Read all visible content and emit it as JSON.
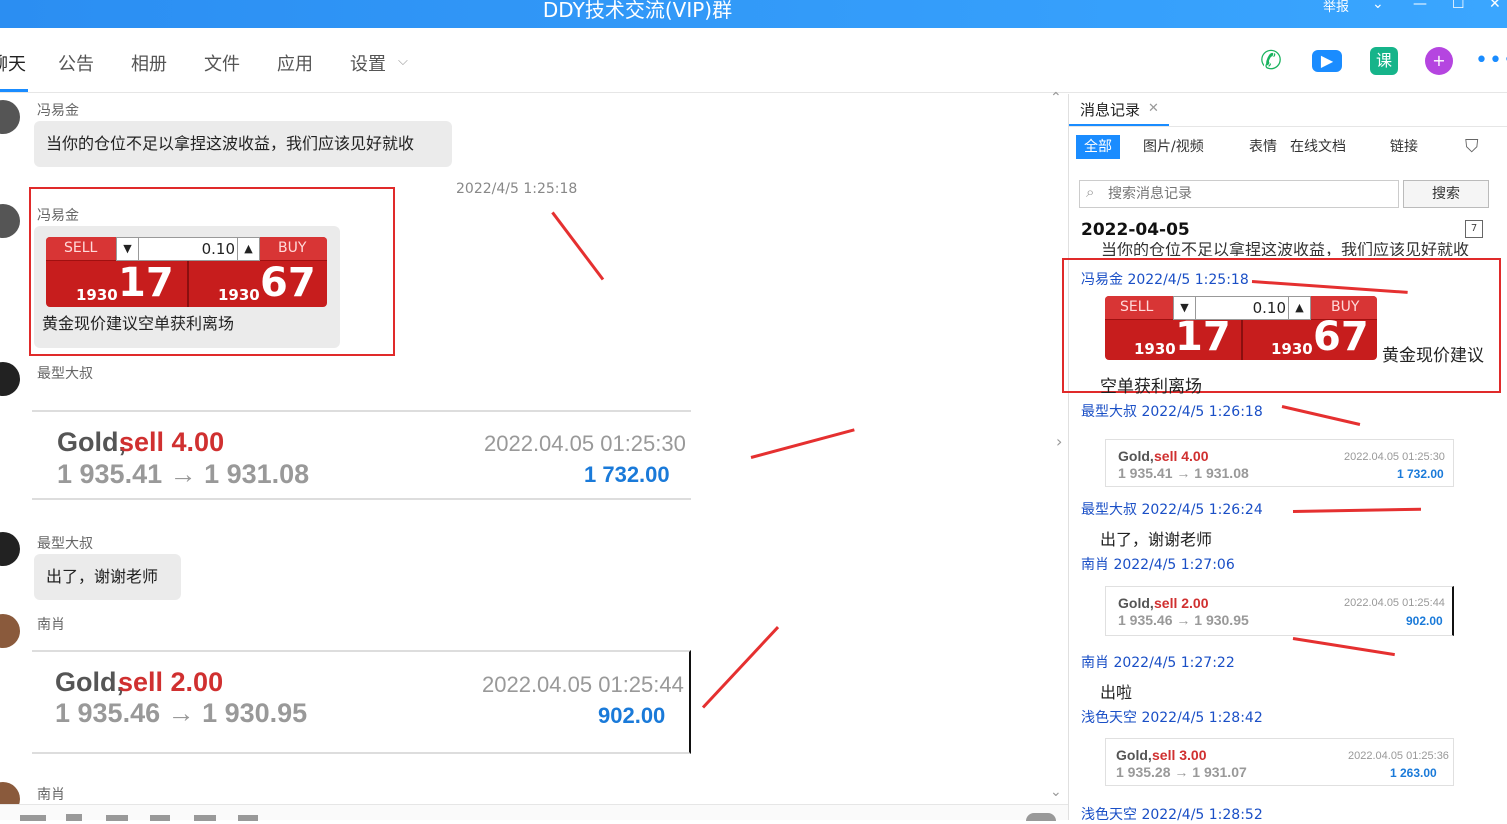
{
  "window": {
    "title": "DDY技术交流(VIP)群",
    "report": "举报"
  },
  "tabs": [
    {
      "label": "聊天"
    },
    {
      "label": "公告"
    },
    {
      "label": "相册"
    },
    {
      "label": "文件"
    },
    {
      "label": "应用"
    },
    {
      "label": "设置"
    }
  ],
  "chat": {
    "messages": [
      {
        "sender": "冯易金",
        "text": "当你的仓位不足以拿捏这波收益，我们应该见好就收"
      },
      {
        "timestamp": "2022/4/5 1:25:18",
        "sender": "冯易金",
        "widget": {
          "sell": "SELL",
          "buy": "BUY",
          "lot": "0.10",
          "sell_small": "1930",
          "sell_big": "17",
          "buy_small": "1930",
          "buy_big": "67"
        },
        "text": "黄金现价建议空单获利离场"
      },
      {
        "sender": "最型大叔",
        "card": {
          "gold": "Gold,",
          "sell": "sell 4.00",
          "prices": "1 935.41 → 1 931.08",
          "date": "2022.04.05 01:25:30",
          "profit": "1 732.00"
        }
      },
      {
        "sender": "最型大叔",
        "text": "出了，谢谢老师"
      },
      {
        "sender": "南肖",
        "card": {
          "gold": "Gold,",
          "sell": "sell 2.00",
          "prices": "1 935.46 → 1 930.95",
          "date": "2022.04.05 01:25:44",
          "profit": "902.00"
        }
      },
      {
        "sender": "南肖"
      }
    ]
  },
  "panel": {
    "title": "消息记录",
    "filters": [
      {
        "label": "全部"
      },
      {
        "label": "图片/视频"
      },
      {
        "label": "表情"
      },
      {
        "label": "在线文档"
      },
      {
        "label": "链接"
      }
    ],
    "search_placeholder": "搜索消息记录",
    "search_button": "搜索",
    "date": "2022-04-05",
    "cut_text": "当你的仓位不足以拿捏这波收益，我们应该见好就收",
    "entries": [
      {
        "header": "冯易金 2022/4/5 1:25:18",
        "widget": {
          "sell": "SELL",
          "buy": "BUY",
          "lot": "0.10",
          "sell_small": "1930",
          "sell_big": "17",
          "buy_small": "1930",
          "buy_big": "67"
        },
        "text1": "黄金现价建议",
        "text2": "空单获利离场"
      },
      {
        "header": "最型大叔 2022/4/5 1:26:18",
        "card": {
          "gold": "Gold,",
          "sell": "sell 4.00",
          "prices": "1 935.41 → 1 931.08",
          "date": "2022.04.05 01:25:30",
          "profit": "1 732.00"
        }
      },
      {
        "header": "最型大叔 2022/4/5 1:26:24",
        "text": "出了，谢谢老师"
      },
      {
        "header": "南肖 2022/4/5 1:27:06",
        "card": {
          "gold": "Gold,",
          "sell": "sell 2.00",
          "prices": "1 935.46 → 1 930.95",
          "date": "2022.04.05 01:25:44",
          "profit": "902.00"
        }
      },
      {
        "header": "南肖 2022/4/5 1:27:22",
        "text": "出啦"
      },
      {
        "header": "浅色天空 2022/4/5 1:28:42",
        "card": {
          "gold": "Gold,",
          "sell": "sell 3.00",
          "prices": "1 935.28 → 1 931.07",
          "date": "2022.04.05 01:25:36",
          "profit": "1 263.00"
        }
      },
      {
        "header": "浅色天空 2022/4/5 1:28:52"
      }
    ]
  },
  "colors": {
    "accent": "#1a8cff",
    "annotation": "#e02a2a",
    "titlebar": "#2b8ef2"
  }
}
